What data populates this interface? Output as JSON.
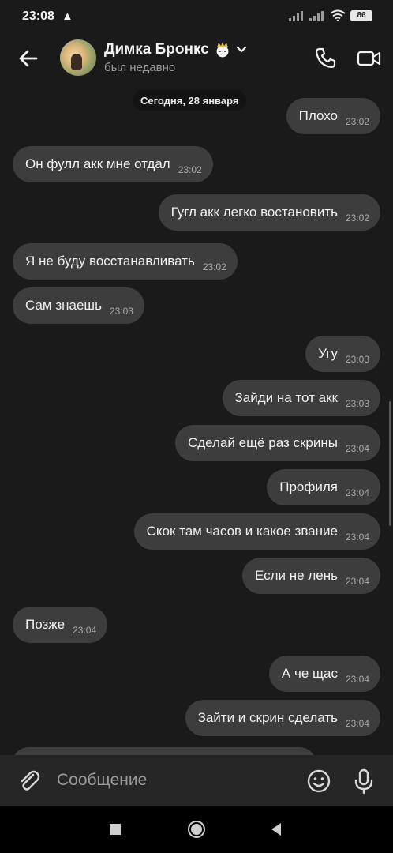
{
  "status_bar": {
    "time": "23:08",
    "warning": "▲",
    "battery": "86"
  },
  "header": {
    "name": "Димка Бронкс",
    "status": "был недавно"
  },
  "date_separator": "Сегодня, 28 января",
  "messages": [
    {
      "dir": "out",
      "text": "Плохо",
      "time": "23:02"
    },
    {
      "dir": "in",
      "text": "Он фулл акк мне отдал",
      "time": "23:02"
    },
    {
      "dir": "out",
      "text": "Гугл акк легко востановить",
      "time": "23:02"
    },
    {
      "dir": "in",
      "text": "Я не буду восстанавливать",
      "time": "23:02"
    },
    {
      "dir": "in",
      "text": "Сам знаешь",
      "time": "23:03"
    },
    {
      "dir": "out",
      "text": "Угу",
      "time": "23:03"
    },
    {
      "dir": "out",
      "text": "Зайди на тот акк",
      "time": "23:03"
    },
    {
      "dir": "out",
      "text": "Сделай ещё раз скрины",
      "time": "23:04"
    },
    {
      "dir": "out",
      "text": "Профиля",
      "time": "23:04"
    },
    {
      "dir": "out",
      "text": "Скок там часов и какое звание",
      "time": "23:04"
    },
    {
      "dir": "out",
      "text": "Если не лень",
      "time": "23:04"
    },
    {
      "dir": "in",
      "text": "Позже",
      "time": "23:04"
    },
    {
      "dir": "out",
      "text": "А че щас",
      "time": "23:04"
    },
    {
      "dir": "out",
      "text": "Зайти и скрин сделать",
      "time": "23:04"
    }
  ],
  "input": {
    "placeholder": "Сообщение"
  },
  "colors": {
    "background": "#1a1a1a",
    "bubble": "#3d3d3d",
    "input_bar": "#262626"
  }
}
